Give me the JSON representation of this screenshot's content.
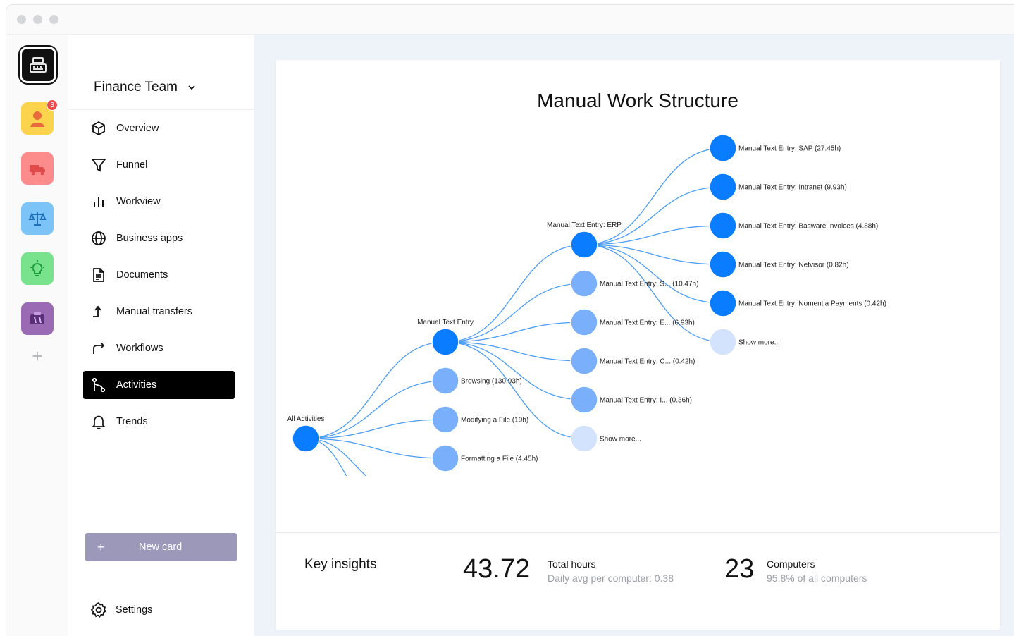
{
  "window": {
    "traffic_lights": [
      "close",
      "minimize",
      "maximize"
    ]
  },
  "rail": {
    "apps": [
      {
        "name": "cash-register-app",
        "bg": "#111111"
      },
      {
        "name": "person-app",
        "bg": "#fcd34d",
        "badge": "3"
      },
      {
        "name": "delivery-truck-app",
        "bg": "#fc8c8c"
      },
      {
        "name": "balance-scale-app",
        "bg": "#7cc4f8"
      },
      {
        "name": "lightbulb-app",
        "bg": "#78e38c"
      },
      {
        "name": "lab-app",
        "bg": "#9a6bb4"
      }
    ],
    "add_label": "+"
  },
  "sidebar": {
    "team": "Finance Team",
    "items": [
      {
        "label": "Overview",
        "icon": "cube-icon"
      },
      {
        "label": "Funnel",
        "icon": "funnel-icon"
      },
      {
        "label": "Workview",
        "icon": "bars-icon"
      },
      {
        "label": "Business apps",
        "icon": "globe-icon"
      },
      {
        "label": "Documents",
        "icon": "document-icon"
      },
      {
        "label": "Manual transfers",
        "icon": "arrow-up-icon"
      },
      {
        "label": "Workflows",
        "icon": "arrow-turn-icon"
      },
      {
        "label": "Activities",
        "icon": "branch-icon",
        "active": true
      },
      {
        "label": "Trends",
        "icon": "bell-icon"
      }
    ],
    "new_card": {
      "plus": "+",
      "label": "New card"
    },
    "settings": "Settings"
  },
  "chart": {
    "title": "Manual Work Structure",
    "colors": {
      "level1": "#0a7cff",
      "level2": "#7ab0fb",
      "more": "#d3e3fd",
      "link": "#4a9cf5"
    },
    "root": {
      "label": "All Activities"
    },
    "level1": [
      {
        "label": "Manual Text Entry",
        "style": "level1"
      },
      {
        "label": "Browsing (130.93h)",
        "style": "level2"
      },
      {
        "label": "Modifying a File (19h)",
        "style": "level2"
      },
      {
        "label": "Formatting a File (4.45h)",
        "style": "level2"
      }
    ],
    "level2": [
      {
        "label": "Manual Text Entry: ERP",
        "style": "level1"
      },
      {
        "label": "Manual Text Entry: S... (10.47h)",
        "style": "level2"
      },
      {
        "label": "Manual Text Entry: E... (6.93h)",
        "style": "level2"
      },
      {
        "label": "Manual Text Entry: C... (0.42h)",
        "style": "level2"
      },
      {
        "label": "Manual Text Entry: I... (0.36h)",
        "style": "level2"
      },
      {
        "label": "Show more...",
        "style": "more"
      }
    ],
    "level3": [
      {
        "label": "Manual Text Entry: SAP (27.45h)",
        "style": "level1"
      },
      {
        "label": "Manual Text Entry: Intranet (9.93h)",
        "style": "level1"
      },
      {
        "label": "Manual Text Entry: Basware Invoices (4.88h)",
        "style": "level1"
      },
      {
        "label": "Manual Text Entry: Netvisor (0.82h)",
        "style": "level1"
      },
      {
        "label": "Manual Text Entry: Nomentia Payments (0.42h)",
        "style": "level1"
      },
      {
        "label": "Show more...",
        "style": "more"
      }
    ]
  },
  "insights": {
    "title": "Key insights",
    "total_hours": {
      "value": "43.72",
      "label": "Total hours",
      "sub": "Daily avg per computer: 0.38"
    },
    "computers": {
      "value": "23",
      "label": "Computers",
      "sub": "95.8% of all computers"
    }
  }
}
